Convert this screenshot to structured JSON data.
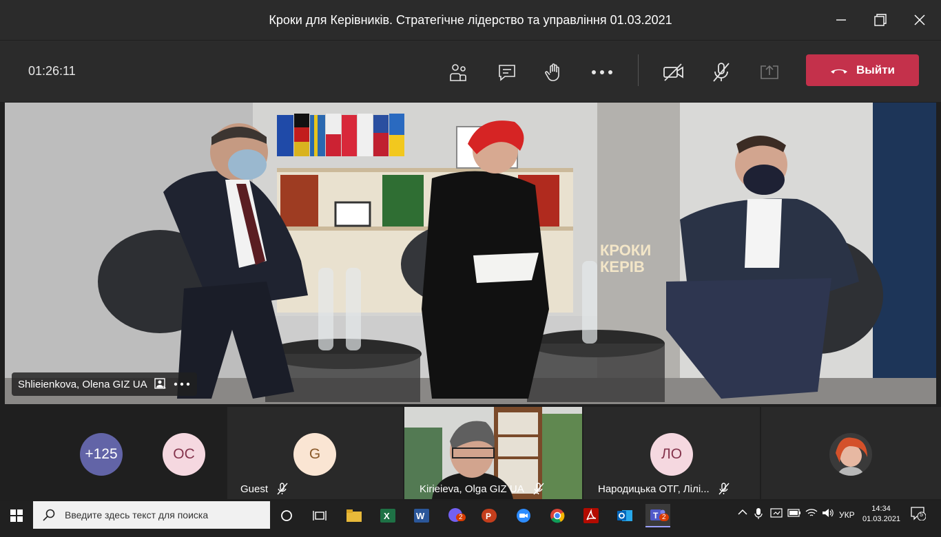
{
  "window": {
    "title": "Кроки для Керівників. Стратегічне лідерство та управління 01.03.2021"
  },
  "meeting": {
    "timer": "01:26:11",
    "leave_label": "Выйти"
  },
  "stage": {
    "speaker_name": "Shlieienkova, Olena GIZ UA",
    "sign_text_1": "КРОКИ",
    "sign_text_2": "КЕРІВ"
  },
  "participants": [
    {
      "label": "+125",
      "color": "#6264a7"
    },
    {
      "label": "ОС",
      "color": "#f5d8e0"
    },
    {
      "initials": "G",
      "name": "Guest",
      "color": "#fae5d3"
    },
    {
      "name": "Kirieieva, Olga GIZ UA"
    },
    {
      "initials": "ЛО",
      "name": "Народицька ОТГ, Лілі...",
      "color": "#f5d8e0"
    },
    {
      "name": ""
    }
  ],
  "taskbar": {
    "search_placeholder": "Введите здесь текст для поиска",
    "language": "УКР",
    "time": "14:34",
    "date": "01.03.2021",
    "notifications": "5",
    "viber_badge": "2",
    "teams_badge": "2"
  }
}
